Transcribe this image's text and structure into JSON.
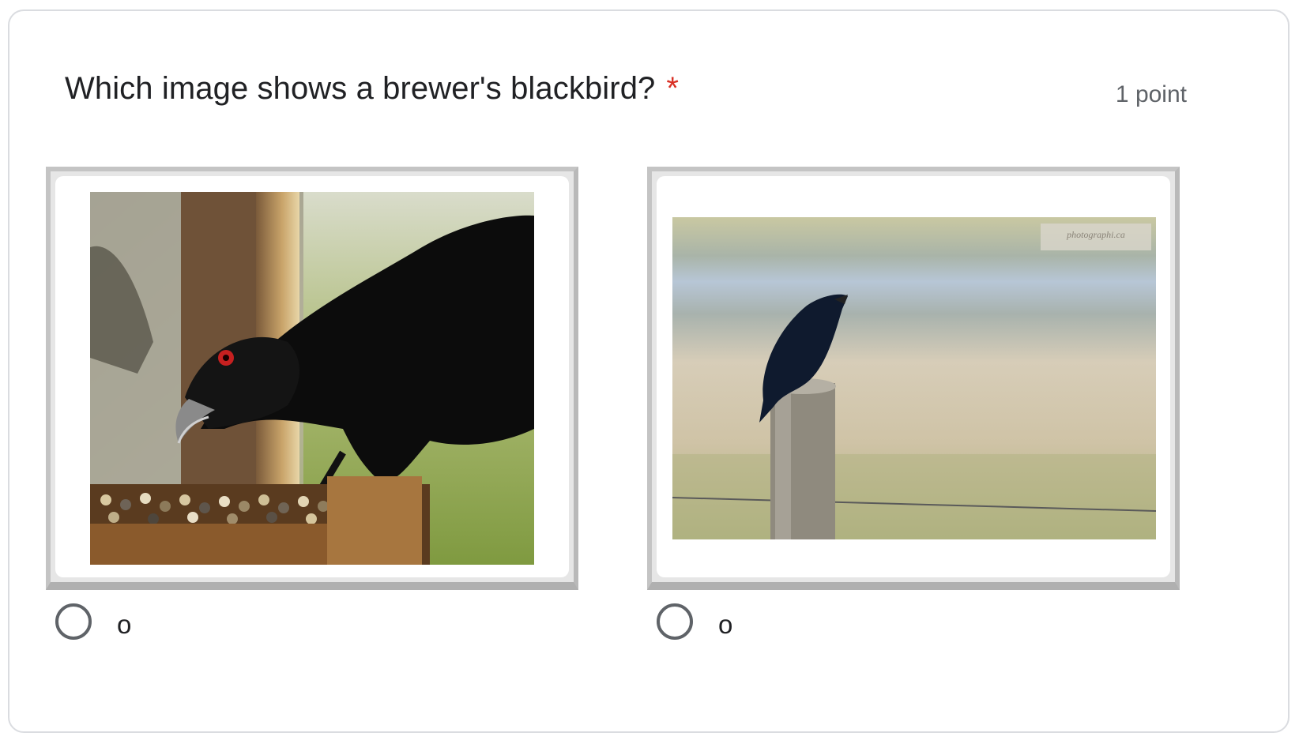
{
  "question": {
    "title": "Which image shows a brewer's blackbird?",
    "required_marker": "*",
    "points": "1 point"
  },
  "options": [
    {
      "label": "o",
      "image": "bird-at-feeder-photo",
      "selected": false
    },
    {
      "label": "o",
      "image": "bird-on-fence-post-photo",
      "selected": false
    }
  ],
  "colors": {
    "required": "#d93025",
    "text": "#202124",
    "secondary_text": "#5f6368",
    "border": "#dadce0"
  },
  "watermark": "photographi.ca"
}
